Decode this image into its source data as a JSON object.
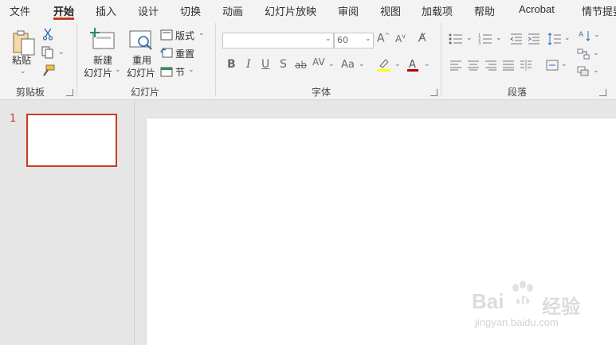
{
  "menu": {
    "tabs": [
      "文件",
      "开始",
      "插入",
      "设计",
      "切换",
      "动画",
      "幻灯片放映",
      "审阅",
      "视图",
      "加载项",
      "帮助",
      "Acrobat",
      "情节提要"
    ],
    "active": "开始"
  },
  "ribbon": {
    "clipboard": {
      "paste": "粘贴",
      "group": "剪贴板"
    },
    "slides": {
      "new_l1": "新建",
      "new_l2": "幻灯片",
      "reuse_l1": "重用",
      "reuse_l2": "幻灯片",
      "layout": "版式",
      "reset": "重置",
      "section": "节",
      "group": "幻灯片"
    },
    "font": {
      "name": "",
      "size": "60",
      "group": "字体"
    },
    "paragraph": {
      "group": "段落"
    }
  },
  "slides_pane": {
    "number": "1"
  },
  "watermark": {
    "brand": "Bai",
    "brand2": "du",
    "text": "经验",
    "url": "jingyan.baidu.com"
  },
  "colors": {
    "accent": "#c43e1c",
    "font_color": "#c00000",
    "highlight": "#ffff00"
  }
}
